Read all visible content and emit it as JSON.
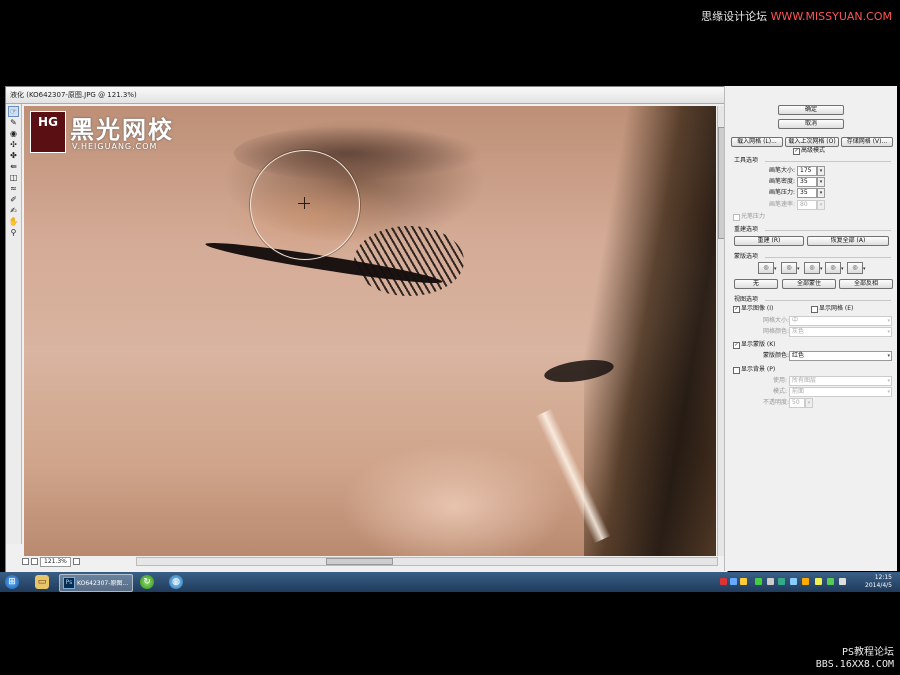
{
  "watermark_top": {
    "brand": "思缘设计论坛",
    "url": "WWW.MISSYUAN.COM"
  },
  "window": {
    "title": "液化 (KO642307-原图.JPG @ 121.3%)"
  },
  "logo": {
    "badge": "HG",
    "name": "黑光网校",
    "url": "V.HEIGUANG.COM"
  },
  "toolbar": {
    "tools": [
      "warp-tool",
      "reconstruct-tool",
      "twirl-tool",
      "pucker-tool",
      "bloat-tool",
      "push-left-tool",
      "mirror-tool",
      "turbulence-tool",
      "freeze-mask-tool",
      "thaw-mask-tool",
      "hand-tool",
      "zoom-tool"
    ]
  },
  "status": {
    "zoom": "121.3%"
  },
  "panel": {
    "ok": "确定",
    "cancel": "取消",
    "load_mesh": "载入网格 (L)...",
    "load_last_mesh": "载入上次网格 (O)",
    "save_mesh": "存储网格 (V)...",
    "advanced_mode": "高级模式",
    "tool_options": {
      "header": "工具选项",
      "brush_size": {
        "label": "画笔大小:",
        "value": "175"
      },
      "brush_density": {
        "label": "画笔密度:",
        "value": "35"
      },
      "brush_pressure": {
        "label": "画笔压力:",
        "value": "35"
      },
      "brush_rate": {
        "label": "画笔速率:",
        "value": "80"
      },
      "stylus_pressure": "光笔压力"
    },
    "reconstruct_options": {
      "header": "重建选项",
      "reconstruct": "重建 (R)",
      "restore_all": "恢复全部 (A)"
    },
    "mask_options": {
      "header": "蒙版选项",
      "none": "无",
      "mask_all": "全部蒙住",
      "invert_all": "全部反相"
    },
    "view_options": {
      "header": "视图选项",
      "show_image": "显示图像 (I)",
      "show_mesh": "显示网格 (E)",
      "mesh_size": {
        "label": "网格大小:",
        "value": "中"
      },
      "mesh_color": {
        "label": "网格颜色:",
        "value": "灰色"
      },
      "show_mask": "显示蒙版 (K)",
      "mask_color": {
        "label": "蒙版颜色:",
        "value": "红色"
      },
      "show_backdrop": "显示背景 (P)",
      "use": {
        "label": "使用:",
        "value": "所有图层"
      },
      "mode": {
        "label": "模式:",
        "value": "前面"
      },
      "opacity": {
        "label": "不透明度:",
        "value": "50"
      }
    }
  },
  "taskbar": {
    "ps_task": "KO642307-原图...",
    "time": "12:15",
    "date": "2014/4/5"
  },
  "watermark_bottom": {
    "name": "PS教程论坛",
    "url": "BBS.16XX8.COM"
  }
}
